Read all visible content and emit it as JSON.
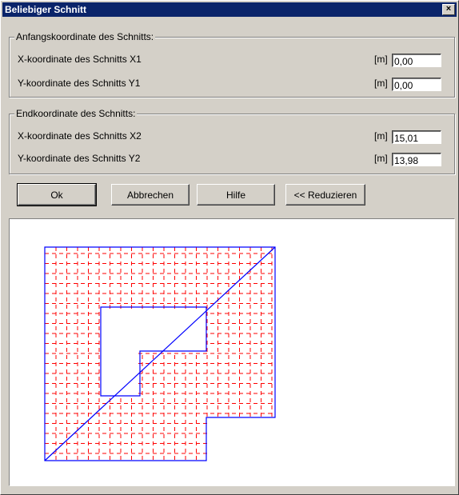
{
  "window": {
    "title": "Beliebiger Schnitt",
    "close_label": "×"
  },
  "start_group": {
    "legend": "Anfangskoordinate des Schnitts:",
    "x_label": "X-koordinate des Schnitts X1",
    "y_label": "Y-koordinate des Schnitts Y1",
    "x_unit": "[m]",
    "y_unit": "[m]",
    "x_value": "0,00",
    "y_value": "0,00"
  },
  "end_group": {
    "legend": "Endkoordinate des Schnitts:",
    "x_label": "X-koordinate des Schnitts X2",
    "y_label": "Y-koordinate des Schnitts Y2",
    "x_unit": "[m]",
    "y_unit": "[m]",
    "x_value": "15,01",
    "y_value": "13,98"
  },
  "buttons": {
    "ok": "Ok",
    "cancel": "Abbrechen",
    "help": "Hilfe",
    "reduce": "<< Reduzieren"
  },
  "colors": {
    "outline": "#0000ff",
    "grid": "#ff0000",
    "cut_line": "#0000ff"
  }
}
